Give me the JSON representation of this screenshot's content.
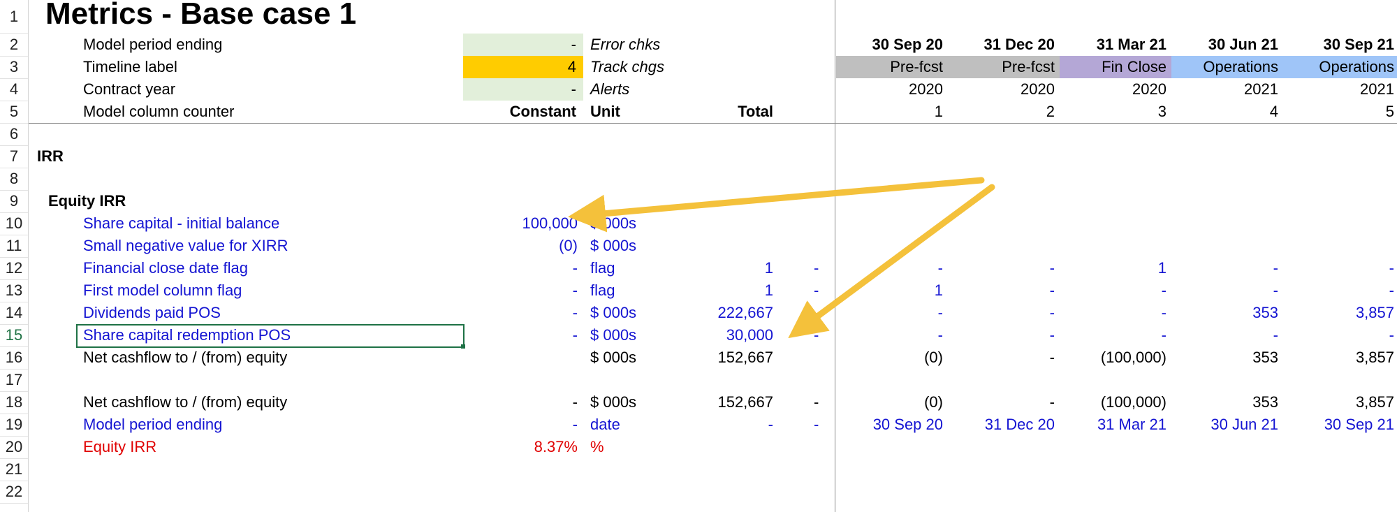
{
  "row_numbers": [
    "1",
    "2",
    "3",
    "4",
    "5",
    "6",
    "7",
    "8",
    "9",
    "10",
    "11",
    "12",
    "13",
    "14",
    "15",
    "16",
    "17",
    "18",
    "19",
    "20",
    "21",
    "22"
  ],
  "title": "Metrics - Base case 1",
  "header_block": {
    "model_period_label": "Model period ending",
    "model_period_value": "-",
    "timeline_label": "Timeline label",
    "timeline_value": "4",
    "contract_year_label": "Contract year",
    "contract_year_value": "-",
    "counter_label": "Model column counter",
    "error_chks": "Error chks",
    "track_chgs": "Track chgs",
    "alerts": "Alerts",
    "constant_hdr": "Constant",
    "unit_hdr": "Unit",
    "total_hdr": "Total"
  },
  "timeline": {
    "dates": [
      "30 Sep 20",
      "31 Dec 20",
      "31 Mar 21",
      "30 Jun 21",
      "30 Sep 21"
    ],
    "phases": [
      "Pre-fcst",
      "Pre-fcst",
      "Fin Close",
      "Operations",
      "Operations"
    ],
    "years": [
      "2020",
      "2020",
      "2020",
      "2021",
      "2021"
    ],
    "counters": [
      "1",
      "2",
      "3",
      "4",
      "5"
    ]
  },
  "sections": {
    "irr": "IRR",
    "equity_irr": "Equity IRR"
  },
  "rows": {
    "r10": {
      "label": "Share capital - initial balance",
      "const": "100,000",
      "unit": "$ 000s"
    },
    "r11": {
      "label": "Small negative value for XIRR",
      "const": "(0)",
      "unit": "$ 000s"
    },
    "r12": {
      "label": "Financial close date flag",
      "const": "-",
      "unit": "flag",
      "total": "1",
      "flag": "-",
      "vals": [
        "-",
        "-",
        "1",
        "-",
        "-"
      ]
    },
    "r13": {
      "label": "First model column flag",
      "const": "-",
      "unit": "flag",
      "total": "1",
      "flag": "-",
      "vals": [
        "1",
        "-",
        "-",
        "-",
        "-"
      ]
    },
    "r14": {
      "label": "Dividends paid POS",
      "const": "-",
      "unit": "$ 000s",
      "total": "222,667",
      "flag": "-",
      "vals": [
        "-",
        "-",
        "-",
        "353",
        "3,857"
      ]
    },
    "r15": {
      "label": "Share capital redemption POS",
      "const": "-",
      "unit": "$ 000s",
      "total": "30,000",
      "flag": "-",
      "vals": [
        "-",
        "-",
        "-",
        "-",
        "-"
      ]
    },
    "r16": {
      "label": "Net cashflow to / (from) equity",
      "unit": "$ 000s",
      "total": "152,667",
      "vals": [
        "(0)",
        "-",
        "(100,000)",
        "353",
        "3,857"
      ]
    },
    "r18": {
      "label": "Net cashflow to / (from) equity",
      "const": "-",
      "unit": "$ 000s",
      "total": "152,667",
      "flag": "-",
      "vals": [
        "(0)",
        "-",
        "(100,000)",
        "353",
        "3,857"
      ]
    },
    "r19": {
      "label": "Model period ending",
      "const": "-",
      "unit": "date",
      "total": "-",
      "flag": "-",
      "vals": [
        "30 Sep 20",
        "31 Dec 20",
        "31 Mar 21",
        "30 Jun 21",
        "30 Sep 21"
      ]
    },
    "r20": {
      "label": "Equity IRR",
      "const": "8.37%",
      "unit": "%"
    }
  },
  "colors": {
    "input_fill": "#e2efda",
    "timeline_fill": "#ffcc00",
    "prefcst_fill": "#bfbfbf",
    "finclose_fill": "#b4a7d6",
    "operations_fill": "#9fc5f8",
    "arrow": "#f4c13b",
    "input_text": "#1414d2",
    "output_text": "#e00000"
  }
}
